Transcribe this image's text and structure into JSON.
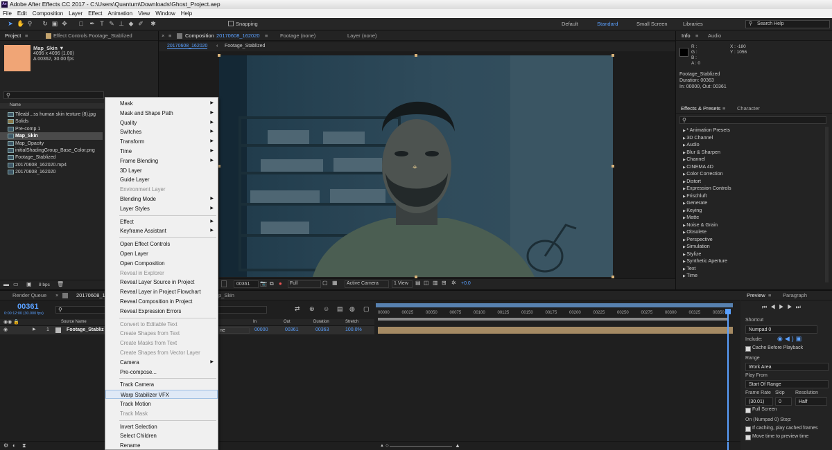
{
  "window": {
    "title": "Adobe After Effects CC 2017 - C:\\Users\\Quantum\\Downloads\\Ghost_Project.aep",
    "app_icon": "Ae"
  },
  "menubar": [
    "File",
    "Edit",
    "Composition",
    "Layer",
    "Effect",
    "Animation",
    "View",
    "Window",
    "Help"
  ],
  "toolbar": {
    "snapping": "Snapping",
    "workspaces": [
      "Default",
      "Standard",
      "Small Screen",
      "Libraries"
    ],
    "active_workspace": "Standard",
    "search_help": "Search Help"
  },
  "project": {
    "tab": "Project",
    "effect_controls_tab": "Effect Controls Footage_Stablized",
    "selected_name": "Map_Skin ▼",
    "selected_dims": "4096 x 4096 (1.00)",
    "selected_duration": "Δ 00362, 30.00 fps",
    "column_name": "Name",
    "items": [
      "Tileabl...ss human skin texture (8).jpg",
      "Solids",
      "Pre-comp 1",
      "Map_Skin",
      "Map_Opacity",
      "initialShadingGroup_Base_Color.png",
      "Footage_Stablized",
      "20170608_162020.mp4",
      "20170608_162020"
    ],
    "bpc": "8 bpc"
  },
  "composition": {
    "tab": "Composition",
    "tab_name": "20170608_162020",
    "footage_tab": "Footage (none)",
    "layer_tab": "Layer (none)",
    "breadcrumb": [
      "20170608_162020",
      "Footage_Stablized"
    ],
    "timecode": "00361",
    "resolution": "Full",
    "camera": "Active Camera",
    "views": "1 View",
    "exposure": "+0.0"
  },
  "info": {
    "tab": "Info",
    "audio_tab": "Audio",
    "r": "R :",
    "g": "G :",
    "b": "B :",
    "a": "A : 0",
    "x": "X : -180",
    "y": "Y : 1056",
    "layer": "Footage_Stablized",
    "duration": "Duration: 00363",
    "inout": "In: 00000, Out: 00361"
  },
  "effects": {
    "tab": "Effects & Presets",
    "char_tab": "Character",
    "items": [
      "* Animation Presets",
      "3D Channel",
      "Audio",
      "Blur & Sharpen",
      "Channel",
      "CINEMA 4D",
      "Color Correction",
      "Distort",
      "Expression Controls",
      "Frischluft",
      "Generate",
      "Keying",
      "Matte",
      "Noise & Grain",
      "Obsolete",
      "Perspective",
      "Simulation",
      "Stylize",
      "Synthetic Aperture",
      "Text",
      "Time"
    ]
  },
  "timeline": {
    "render_queue": "Render Queue",
    "comp_tab": "20170608_16",
    "other_tab": "p_Skin",
    "timecode": "00361",
    "timecode_sub": "0:00:12:00 (30.000 fps)",
    "col_source": "Source Name",
    "col_in": "In",
    "col_out": "Out",
    "col_duration": "Duration",
    "col_stretch": "Stretch",
    "layer_num": "1",
    "layer_name": "Footage_Stabliz",
    "layer_mode": "ne",
    "layer_in": "00000",
    "layer_out": "00361",
    "layer_duration": "00363",
    "layer_stretch": "100.0%",
    "ruler": [
      "00000",
      "00025",
      "00050",
      "00075",
      "00100",
      "00125",
      "00150",
      "00175",
      "00200",
      "00225",
      "00250",
      "00275",
      "00300",
      "00325",
      "00350"
    ]
  },
  "preview": {
    "tab": "Preview",
    "para_tab": "Paragraph",
    "shortcut_label": "Shortcut",
    "shortcut": "Numpad 0",
    "include": "Include:",
    "cache": "Cache Before Playback",
    "range_label": "Range",
    "range": "Work Area",
    "playfrom_label": "Play From",
    "playfrom": "Start Of Range",
    "framerate_label": "Frame Rate",
    "skip_label": "Skip",
    "res_label": "Resolution",
    "framerate": "(30.01)",
    "skip": "0",
    "res": "Half",
    "fullscreen": "Full Screen",
    "stop_label": "On (Numpad 0) Stop:",
    "if_caching": "If caching, play cached frames",
    "move_time": "Move time to preview time"
  },
  "context_menu": [
    {
      "label": "Mask",
      "sub": true
    },
    {
      "label": "Mask and Shape Path",
      "sub": true
    },
    {
      "label": "Quality",
      "sub": true
    },
    {
      "label": "Switches",
      "sub": true
    },
    {
      "label": "Transform",
      "sub": true
    },
    {
      "label": "Time",
      "sub": true
    },
    {
      "label": "Frame Blending",
      "sub": true
    },
    {
      "label": "3D Layer"
    },
    {
      "label": "Guide Layer"
    },
    {
      "label": "Environment Layer",
      "dis": true
    },
    {
      "label": "Blending Mode",
      "sub": true
    },
    {
      "label": "Layer Styles",
      "sub": true
    },
    {
      "sep": true
    },
    {
      "label": "Effect",
      "sub": true
    },
    {
      "label": "Keyframe Assistant",
      "sub": true
    },
    {
      "sep": true
    },
    {
      "label": "Open Effect Controls"
    },
    {
      "label": "Open Layer"
    },
    {
      "label": "Open Composition"
    },
    {
      "label": "Reveal in Explorer",
      "dis": true
    },
    {
      "label": "Reveal Layer Source in Project"
    },
    {
      "label": "Reveal Layer in Project Flowchart"
    },
    {
      "label": "Reveal Composition in Project"
    },
    {
      "label": "Reveal Expression Errors"
    },
    {
      "sep": true
    },
    {
      "label": "Convert to Editable Text",
      "dis": true
    },
    {
      "label": "Create Shapes from Text",
      "dis": true
    },
    {
      "label": "Create Masks from Text",
      "dis": true
    },
    {
      "label": "Create Shapes from Vector Layer",
      "dis": true
    },
    {
      "label": "Camera",
      "sub": true
    },
    {
      "label": "Pre-compose..."
    },
    {
      "sep": true
    },
    {
      "label": "Track Camera"
    },
    {
      "label": "Warp Stabilizer VFX",
      "hl": true
    },
    {
      "label": "Track Motion"
    },
    {
      "label": "Track Mask",
      "dis": true
    },
    {
      "sep": true
    },
    {
      "label": "Invert Selection"
    },
    {
      "label": "Select Children"
    },
    {
      "label": "Rename"
    }
  ],
  "colors": {
    "accent": "#5aa0ff",
    "menu_bg": "#f0f0f0",
    "panel_bg": "#232323",
    "layer_bar": "#a58a63"
  }
}
